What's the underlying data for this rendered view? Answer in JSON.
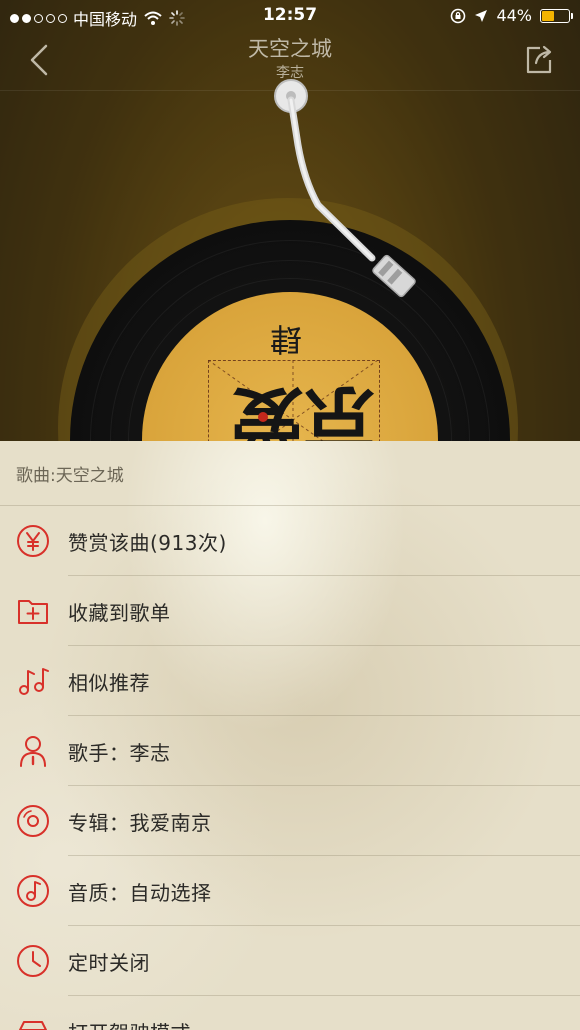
{
  "status_bar": {
    "carrier": "中国移动",
    "time": "12:57",
    "battery": "44%",
    "battery_fraction": 0.44
  },
  "header": {
    "song_title": "天空之城",
    "artist": "李志",
    "back_icon": "chevron-left-icon",
    "share_icon": "share-icon"
  },
  "album_art": {
    "glyphs": [
      "肆",
      "爱",
      "京"
    ]
  },
  "sheet": {
    "title": "歌曲:天空之城",
    "items": [
      {
        "label": "赞赏该曲(913次)",
        "icon": "yen-coin-icon"
      },
      {
        "label": "收藏到歌单",
        "icon": "folder-plus-icon"
      },
      {
        "label": "相似推荐",
        "icon": "music-notes-icon"
      },
      {
        "label": "歌手：李志",
        "icon": "singer-icon"
      },
      {
        "label": "专辑：我爱南京",
        "icon": "album-disc-icon"
      },
      {
        "label": "音质：自动选择",
        "icon": "music-quality-icon"
      },
      {
        "label": "定时关闭",
        "icon": "clock-icon"
      },
      {
        "label": "打开驾驶模式",
        "icon": "car-icon"
      }
    ]
  },
  "colors": {
    "accent_red": "#d8312a",
    "sheet_bg": "#e6dfc9",
    "label_gold": "#d9a43b"
  }
}
